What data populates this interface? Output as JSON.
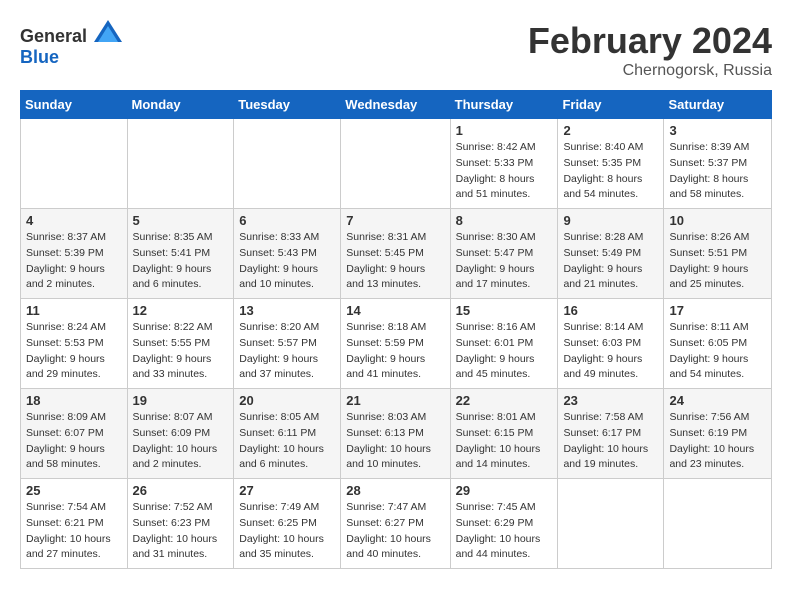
{
  "header": {
    "logo_general": "General",
    "logo_blue": "Blue",
    "month": "February 2024",
    "location": "Chernogorsk, Russia"
  },
  "weekdays": [
    "Sunday",
    "Monday",
    "Tuesday",
    "Wednesday",
    "Thursday",
    "Friday",
    "Saturday"
  ],
  "weeks": [
    [
      {
        "day": "",
        "info": ""
      },
      {
        "day": "",
        "info": ""
      },
      {
        "day": "",
        "info": ""
      },
      {
        "day": "",
        "info": ""
      },
      {
        "day": "1",
        "info": "Sunrise: 8:42 AM\nSunset: 5:33 PM\nDaylight: 8 hours\nand 51 minutes."
      },
      {
        "day": "2",
        "info": "Sunrise: 8:40 AM\nSunset: 5:35 PM\nDaylight: 8 hours\nand 54 minutes."
      },
      {
        "day": "3",
        "info": "Sunrise: 8:39 AM\nSunset: 5:37 PM\nDaylight: 8 hours\nand 58 minutes."
      }
    ],
    [
      {
        "day": "4",
        "info": "Sunrise: 8:37 AM\nSunset: 5:39 PM\nDaylight: 9 hours\nand 2 minutes."
      },
      {
        "day": "5",
        "info": "Sunrise: 8:35 AM\nSunset: 5:41 PM\nDaylight: 9 hours\nand 6 minutes."
      },
      {
        "day": "6",
        "info": "Sunrise: 8:33 AM\nSunset: 5:43 PM\nDaylight: 9 hours\nand 10 minutes."
      },
      {
        "day": "7",
        "info": "Sunrise: 8:31 AM\nSunset: 5:45 PM\nDaylight: 9 hours\nand 13 minutes."
      },
      {
        "day": "8",
        "info": "Sunrise: 8:30 AM\nSunset: 5:47 PM\nDaylight: 9 hours\nand 17 minutes."
      },
      {
        "day": "9",
        "info": "Sunrise: 8:28 AM\nSunset: 5:49 PM\nDaylight: 9 hours\nand 21 minutes."
      },
      {
        "day": "10",
        "info": "Sunrise: 8:26 AM\nSunset: 5:51 PM\nDaylight: 9 hours\nand 25 minutes."
      }
    ],
    [
      {
        "day": "11",
        "info": "Sunrise: 8:24 AM\nSunset: 5:53 PM\nDaylight: 9 hours\nand 29 minutes."
      },
      {
        "day": "12",
        "info": "Sunrise: 8:22 AM\nSunset: 5:55 PM\nDaylight: 9 hours\nand 33 minutes."
      },
      {
        "day": "13",
        "info": "Sunrise: 8:20 AM\nSunset: 5:57 PM\nDaylight: 9 hours\nand 37 minutes."
      },
      {
        "day": "14",
        "info": "Sunrise: 8:18 AM\nSunset: 5:59 PM\nDaylight: 9 hours\nand 41 minutes."
      },
      {
        "day": "15",
        "info": "Sunrise: 8:16 AM\nSunset: 6:01 PM\nDaylight: 9 hours\nand 45 minutes."
      },
      {
        "day": "16",
        "info": "Sunrise: 8:14 AM\nSunset: 6:03 PM\nDaylight: 9 hours\nand 49 minutes."
      },
      {
        "day": "17",
        "info": "Sunrise: 8:11 AM\nSunset: 6:05 PM\nDaylight: 9 hours\nand 54 minutes."
      }
    ],
    [
      {
        "day": "18",
        "info": "Sunrise: 8:09 AM\nSunset: 6:07 PM\nDaylight: 9 hours\nand 58 minutes."
      },
      {
        "day": "19",
        "info": "Sunrise: 8:07 AM\nSunset: 6:09 PM\nDaylight: 10 hours\nand 2 minutes."
      },
      {
        "day": "20",
        "info": "Sunrise: 8:05 AM\nSunset: 6:11 PM\nDaylight: 10 hours\nand 6 minutes."
      },
      {
        "day": "21",
        "info": "Sunrise: 8:03 AM\nSunset: 6:13 PM\nDaylight: 10 hours\nand 10 minutes."
      },
      {
        "day": "22",
        "info": "Sunrise: 8:01 AM\nSunset: 6:15 PM\nDaylight: 10 hours\nand 14 minutes."
      },
      {
        "day": "23",
        "info": "Sunrise: 7:58 AM\nSunset: 6:17 PM\nDaylight: 10 hours\nand 19 minutes."
      },
      {
        "day": "24",
        "info": "Sunrise: 7:56 AM\nSunset: 6:19 PM\nDaylight: 10 hours\nand 23 minutes."
      }
    ],
    [
      {
        "day": "25",
        "info": "Sunrise: 7:54 AM\nSunset: 6:21 PM\nDaylight: 10 hours\nand 27 minutes."
      },
      {
        "day": "26",
        "info": "Sunrise: 7:52 AM\nSunset: 6:23 PM\nDaylight: 10 hours\nand 31 minutes."
      },
      {
        "day": "27",
        "info": "Sunrise: 7:49 AM\nSunset: 6:25 PM\nDaylight: 10 hours\nand 35 minutes."
      },
      {
        "day": "28",
        "info": "Sunrise: 7:47 AM\nSunset: 6:27 PM\nDaylight: 10 hours\nand 40 minutes."
      },
      {
        "day": "29",
        "info": "Sunrise: 7:45 AM\nSunset: 6:29 PM\nDaylight: 10 hours\nand 44 minutes."
      },
      {
        "day": "",
        "info": ""
      },
      {
        "day": "",
        "info": ""
      }
    ]
  ]
}
